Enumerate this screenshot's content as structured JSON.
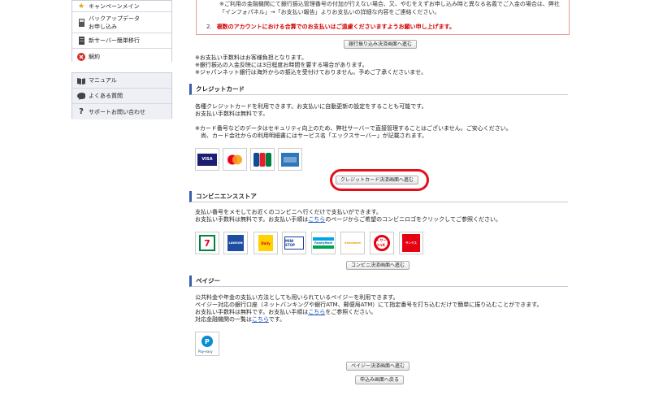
{
  "sidebar": {
    "top_items": [
      {
        "label": "キャンペーンメイン",
        "icon": "star-icon"
      },
      {
        "label": "バックアップデータ\nお申し込み",
        "icon": "backup-icon"
      },
      {
        "label": "新サーバー簡単移行",
        "icon": "server-icon"
      },
      {
        "label": "解約",
        "icon": "cancel-icon"
      }
    ],
    "bottom_items": [
      {
        "label": "マニュアル",
        "icon": "book-icon"
      },
      {
        "label": "よくある質問",
        "icon": "speech-bubble-icon"
      },
      {
        "label": "サポートお問い合わせ",
        "icon": "question-icon"
      }
    ]
  },
  "bank_notice": {
    "text": "※ご利用の金融機関にて銀行振込管理番号の付加が行えない場合、又、やむをえずお申し込み時と異なる名義でご入金の場合は、弊社「インフォパネル」→「お支払い報告」よりお支払いの詳細な内容をご連絡ください。",
    "item_number": "2.",
    "item_text": "複数のアカウントにおける合算でのお支払いはご遠慮くださいますようお願い申し上げます。"
  },
  "bank_button": "銀行振り込み決済画面へ進む",
  "bank_notes": [
    "※お支払い手数料はお客様負担となります。",
    "※銀行振込の入金反映には3日程度お時間を要する場合があります。",
    "※ジャパンネット銀行は海外からの振込を受付けておりません。予めご了承くださいませ。"
  ],
  "credit": {
    "heading": "クレジットカード",
    "line1": "各種クレジットカードを利用できます。お支払いに自動更新の設定をすることも可能です。",
    "line2": "お支払い手数料は無料です。",
    "line3": "※カード番号などのデータはセキュリティ向上のため、弊社サーバーで直接管理することはございません。ご安心ください。",
    "line4": "尚、カード会社からの利用明細書にはサービス名「エックスサーバー」が記載されます。",
    "logos": [
      "VISA",
      "MasterCard",
      "JCB",
      "AMEX"
    ],
    "button": "クレジットカード決済画面へ進む"
  },
  "conveni": {
    "heading": "コンビニエンスストア",
    "line1": "支払い番号をメモしてお近くのコンビニへ行くだけで支払いができます。",
    "line2_pre": "お支払い手数料は無料です。お支払い手順は",
    "line2_link": "こちら",
    "line2_post": "のページからご希望のコンビニロゴをクリックしてご参照ください。",
    "logos": [
      "7",
      "LAWSON",
      "Daily",
      "MINI STOP",
      "FamilyMart",
      "Seicomart",
      "K サークルK",
      "サンクス"
    ],
    "button": "コンビニ決済画面へ進む"
  },
  "payeasy": {
    "heading": "ペイジー",
    "line1": "公共料金や年金の支払い方法としても用いられているペイジーを利用できます。",
    "line2": "ペイジー対応の銀行口座（ネットバンキングや銀行ATM、郵便局ATM）にて指定番号を打ち込むだけで簡単に振り込むことができます。",
    "line3_pre": "お支払い手数料は無料です。お支払い手順は",
    "line3_link": "こちら",
    "line3_post": "をご参照ください。",
    "line4_pre": "対応金融機関の一覧は",
    "line4_link": "こちら",
    "line4_post": "です。",
    "logo_text": "Pay-easy",
    "button": "ペイジー決済画面へ進む",
    "back_button": "申込み画面へ戻る"
  }
}
